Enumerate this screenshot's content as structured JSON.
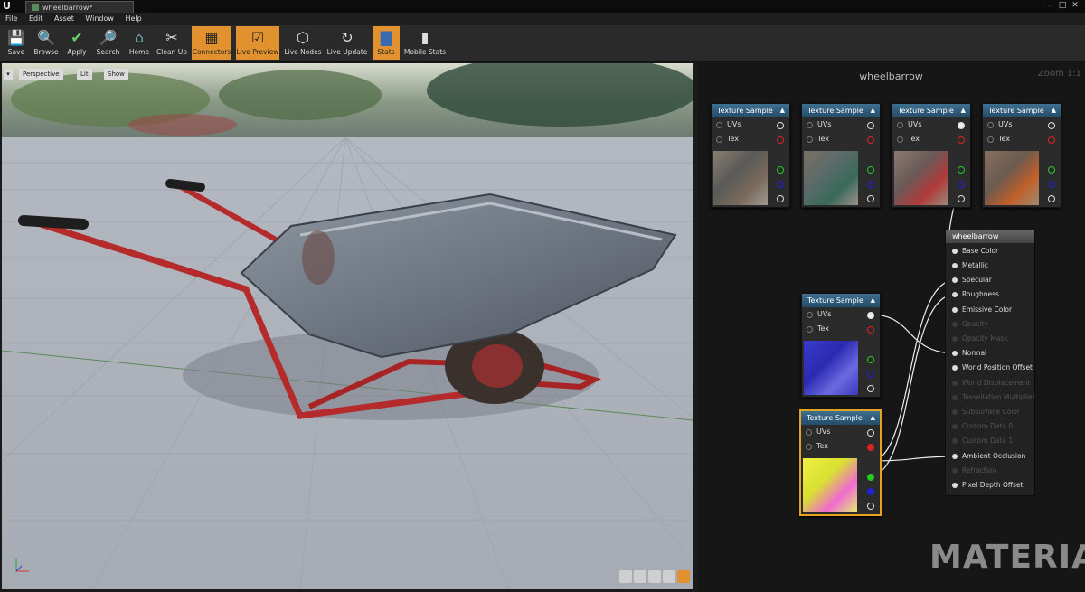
{
  "window": {
    "logo": "U",
    "tab_title": "wheelbarrow*",
    "controls": [
      "–",
      "□",
      "✕"
    ]
  },
  "menu": [
    "File",
    "Edit",
    "Asset",
    "Window",
    "Help"
  ],
  "toolbar": [
    {
      "label": "Save",
      "icon": "save-icon",
      "glyph": "💾",
      "active": false
    },
    {
      "label": "Browse",
      "icon": "browse-icon",
      "glyph": "🔍",
      "active": false
    },
    {
      "label": "Apply",
      "icon": "apply-icon",
      "glyph": "✔",
      "active": false
    },
    {
      "label": "Search",
      "icon": "search-icon",
      "glyph": "🔎",
      "active": false
    },
    {
      "label": "Home",
      "icon": "home-icon",
      "glyph": "⌂",
      "active": false
    },
    {
      "label": "Clean Up",
      "icon": "clean-up-icon",
      "glyph": "✂",
      "active": false
    },
    {
      "label": "Connectors",
      "icon": "connectors-icon",
      "glyph": "▦",
      "active": true
    },
    {
      "label": "Live Preview",
      "icon": "live-preview-icon",
      "glyph": "☑",
      "active": true
    },
    {
      "label": "Live Nodes",
      "icon": "live-nodes-icon",
      "glyph": "⬡",
      "active": false
    },
    {
      "label": "Live Update",
      "icon": "live-update-icon",
      "glyph": "↻",
      "active": false
    },
    {
      "label": "Stats",
      "icon": "stats-icon",
      "glyph": "▇",
      "active": true
    },
    {
      "label": "Mobile Stats",
      "icon": "mobile-stats-icon",
      "glyph": "▮",
      "active": false
    }
  ],
  "viewport": {
    "menu_icon": "▾",
    "perspective_label": "Perspective",
    "lit_label": "Lit",
    "show_label": "Show"
  },
  "graph": {
    "title": "wheelbarrow",
    "zoom": "Zoom 1:1",
    "watermark": "MATERIAL"
  },
  "texture_nodes": [
    {
      "title": "Texture Sample",
      "in_uvs": "UVs",
      "in_tex": "Tex",
      "thumb": "base-color"
    },
    {
      "title": "Texture Sample",
      "in_uvs": "UVs",
      "in_tex": "Tex",
      "thumb": "base-color-2"
    },
    {
      "title": "Texture Sample",
      "in_uvs": "UVs",
      "in_tex": "Tex",
      "thumb": "base-color-3"
    },
    {
      "title": "Texture Sample",
      "in_uvs": "UVs",
      "in_tex": "Tex",
      "thumb": "base-color-4"
    },
    {
      "title": "Texture Sample",
      "in_uvs": "UVs",
      "in_tex": "Tex",
      "thumb": "normal-map"
    },
    {
      "title": "Texture Sample",
      "in_uvs": "UVs",
      "in_tex": "Tex",
      "thumb": "orm-map"
    }
  ],
  "material_node": {
    "title": "wheelbarrow",
    "inputs": [
      {
        "label": "Base Color",
        "enabled": true
      },
      {
        "label": "Metallic",
        "enabled": true
      },
      {
        "label": "Specular",
        "enabled": true
      },
      {
        "label": "Roughness",
        "enabled": true
      },
      {
        "label": "Emissive Color",
        "enabled": true
      },
      {
        "label": "Opacity",
        "enabled": false
      },
      {
        "label": "Opacity Mask",
        "enabled": false
      },
      {
        "label": "Normal",
        "enabled": true
      },
      {
        "label": "World Position Offset",
        "enabled": true
      },
      {
        "label": "World Displacement",
        "enabled": false
      },
      {
        "label": "Tessellation Multiplier",
        "enabled": false
      },
      {
        "label": "Subsurface Color",
        "enabled": false
      },
      {
        "label": "Custom Data 0",
        "enabled": false
      },
      {
        "label": "Custom Data 1",
        "enabled": false
      },
      {
        "label": "Ambient Occlusion",
        "enabled": true
      },
      {
        "label": "Refraction",
        "enabled": false
      },
      {
        "label": "Pixel Depth Offset",
        "enabled": true
      }
    ]
  },
  "colors": {
    "toolbar_active": "#e1922e",
    "node_header": "#2f5d7c",
    "selection": "#e5a320",
    "pin_red": "#d22",
    "pin_green": "#2c2",
    "pin_blue": "#22d"
  }
}
